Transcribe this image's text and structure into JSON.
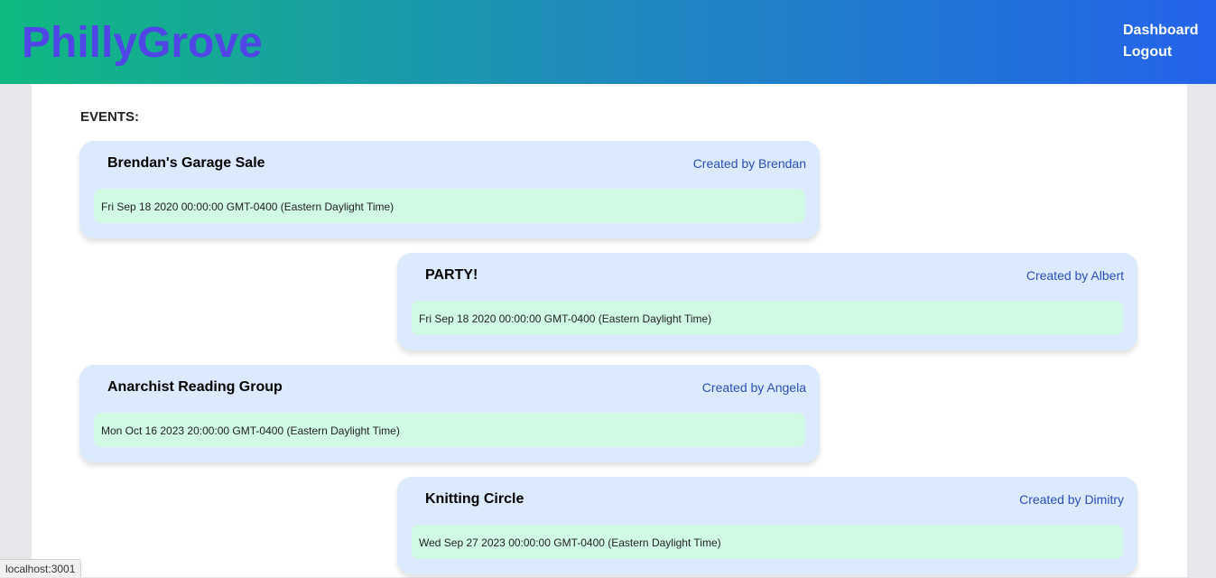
{
  "header": {
    "brand": "PhillyGrove",
    "nav": {
      "dashboard": "Dashboard",
      "logout": "Logout"
    }
  },
  "main": {
    "heading": "EVENTS:",
    "events": [
      {
        "title": "Brendan's Garage Sale",
        "author": "Created by Brendan",
        "date": "Fri Sep 18 2020 00:00:00 GMT-0400 (Eastern Daylight Time)"
      },
      {
        "title": "PARTY!",
        "author": "Created by Albert",
        "date": "Fri Sep 18 2020 00:00:00 GMT-0400 (Eastern Daylight Time)"
      },
      {
        "title": "Anarchist Reading Group",
        "author": "Created by Angela",
        "date": "Mon Oct 16 2023 20:00:00 GMT-0400 (Eastern Daylight Time)"
      },
      {
        "title": "Knitting Circle",
        "author": "Created by Dimitry",
        "date": "Wed Sep 27 2023 00:00:00 GMT-0400 (Eastern Daylight Time)"
      }
    ]
  },
  "statusbar": {
    "url": "localhost:3001"
  },
  "colors": {
    "brand": "#4f46e5",
    "header_start": "#10b981",
    "header_end": "#2563eb",
    "card_bg": "#dbeafe",
    "date_bg": "#d1fae5",
    "author": "#2c4fb8"
  }
}
